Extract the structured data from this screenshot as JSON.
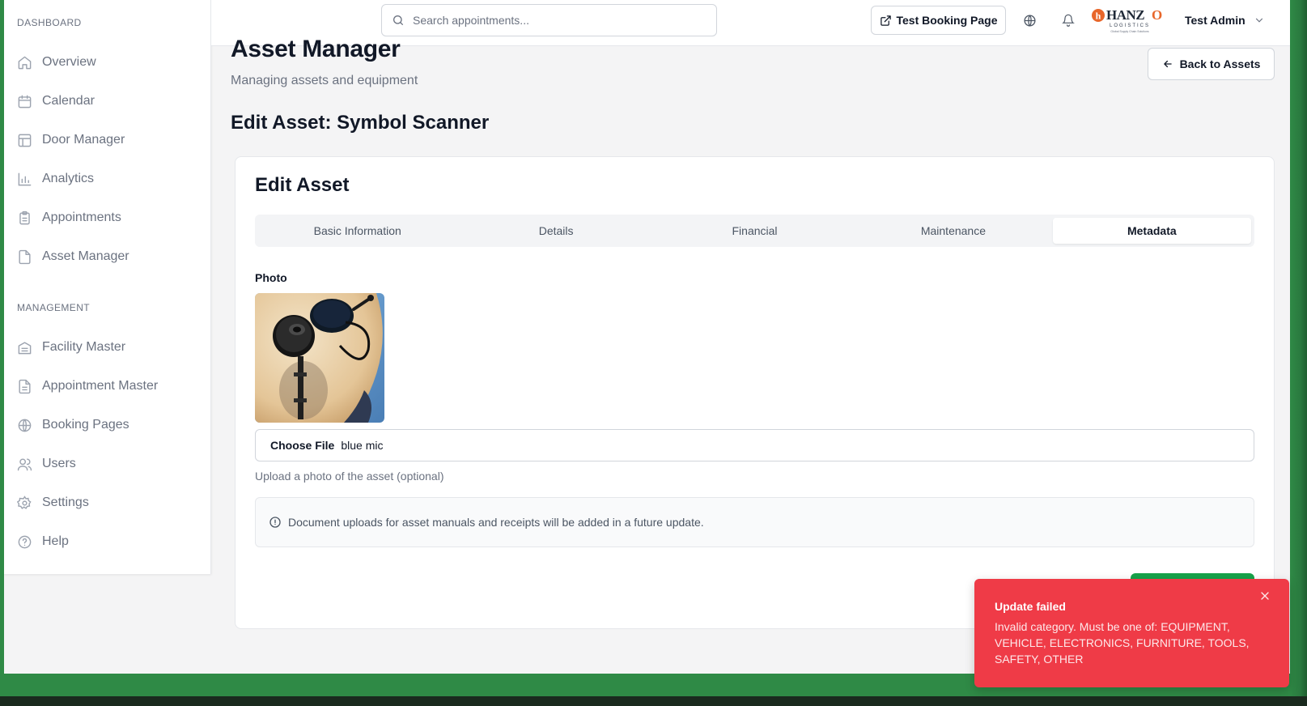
{
  "sidebar": {
    "dashboard_label": "DASHBOARD",
    "management_label": "MANAGEMENT",
    "dashboard_items": [
      {
        "label": "Overview",
        "icon": "home-icon"
      },
      {
        "label": "Calendar",
        "icon": "calendar-icon"
      },
      {
        "label": "Door Manager",
        "icon": "layout-icon"
      },
      {
        "label": "Analytics",
        "icon": "bar-chart-icon"
      },
      {
        "label": "Appointments",
        "icon": "clipboard-icon"
      },
      {
        "label": "Asset Manager",
        "icon": "file-icon"
      }
    ],
    "management_items": [
      {
        "label": "Facility Master",
        "icon": "warehouse-icon"
      },
      {
        "label": "Appointment Master",
        "icon": "file-text-icon"
      },
      {
        "label": "Booking Pages",
        "icon": "globe-icon"
      },
      {
        "label": "Users",
        "icon": "users-icon"
      },
      {
        "label": "Settings",
        "icon": "gear-icon"
      },
      {
        "label": "Help",
        "icon": "help-circle-icon"
      }
    ]
  },
  "topbar": {
    "search_placeholder": "Search appointments...",
    "booking_button": "Test Booking Page",
    "user_name": "Test Admin",
    "logo_text": "HANZO",
    "logo_subtext": "LOGISTICS"
  },
  "page": {
    "title": "Asset Manager",
    "subtitle": "Managing assets and equipment",
    "back_button": "Back to Assets",
    "edit_heading": "Edit Asset: Symbol Scanner"
  },
  "card": {
    "title": "Edit Asset",
    "tabs": [
      "Basic Information",
      "Details",
      "Financial",
      "Maintenance",
      "Metadata"
    ],
    "active_tab": "Metadata",
    "photo_label": "Photo",
    "file_button": "Choose File",
    "file_name": "blue mic",
    "help_text": "Upload a photo of the asset (optional)",
    "notice": "Document uploads for asset manuals and receipts will be added in a future update."
  },
  "toast": {
    "title": "Update failed",
    "message": "Invalid category. Must be one of: EQUIPMENT, VEHICLE, ELECTRONICS, FURNITURE, TOOLS, SAFETY, OTHER"
  },
  "colors": {
    "frame_green": "#2f8a46",
    "save_green": "#16a34a",
    "toast_red": "#ef3b47",
    "logo_orange": "#e8662a"
  }
}
